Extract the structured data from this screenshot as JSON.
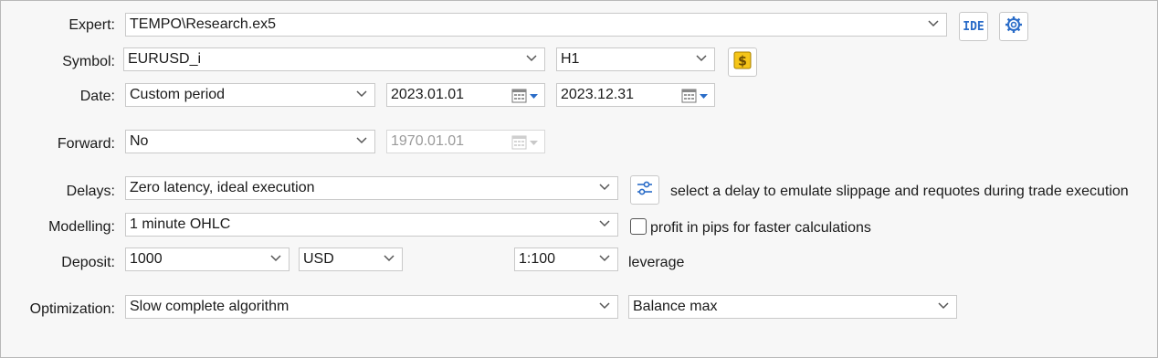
{
  "labels": {
    "expert": "Expert:",
    "symbol": "Symbol:",
    "date": "Date:",
    "forward": "Forward:",
    "delays": "Delays:",
    "modelling": "Modelling:",
    "deposit": "Deposit:",
    "optimization": "Optimization:"
  },
  "expert": {
    "value": "TEMPO\\Research.ex5",
    "ide_label": "IDE",
    "settings_icon": "gear-icon"
  },
  "symbol": {
    "value": "EURUSD_i",
    "timeframe": "H1",
    "spec_icon": "dollar-icon"
  },
  "date": {
    "period": "Custom period",
    "from": "2023.01.01",
    "to": "2023.12.31"
  },
  "forward": {
    "value": "No",
    "date": "1970.01.01"
  },
  "delays": {
    "value": "Zero latency, ideal execution",
    "hint": "select a delay to emulate slippage and requotes during trade execution",
    "icon": "sliders-icon"
  },
  "modelling": {
    "value": "1 minute OHLC",
    "checkbox_label": "profit in pips for faster calculations",
    "checked": false
  },
  "deposit": {
    "amount": "1000",
    "currency": "USD",
    "leverage": "1:100",
    "leverage_label": "leverage"
  },
  "optimization": {
    "algorithm": "Slow complete algorithm",
    "criterion": "Balance max"
  },
  "colors": {
    "accent": "#2a6cc8",
    "dollar_bg": "#f5c518"
  }
}
